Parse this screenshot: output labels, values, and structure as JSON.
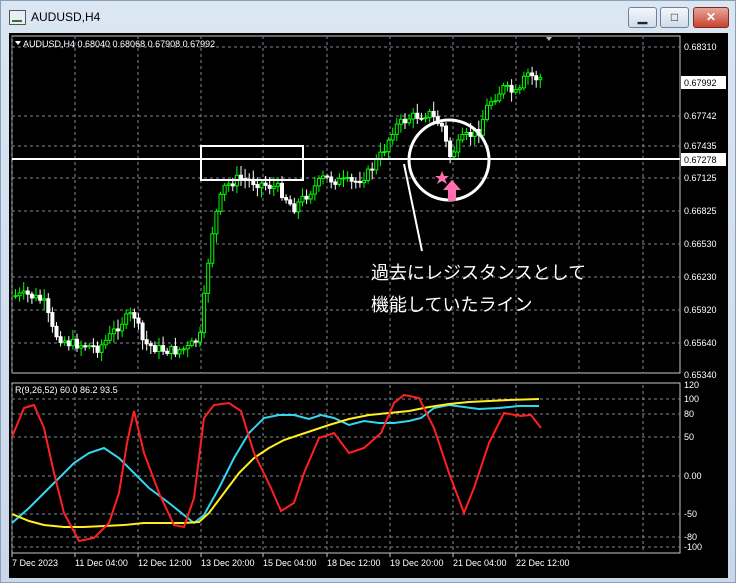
{
  "window": {
    "title": "AUDUSD,H4",
    "minimize_glyph": "▁",
    "maximize_glyph": "□",
    "close_glyph": "✕"
  },
  "chart": {
    "info": "AUDUSD,H4  0.68040 0.68068 0.67908 0.67992",
    "price_ticks": [
      "0.68310",
      "0.67742",
      "0.67435",
      "0.67125",
      "0.66825",
      "0.66530",
      "0.66230",
      "0.65920",
      "0.65640",
      "0.65340"
    ],
    "current_price": "0.67992",
    "line_price": "0.67278",
    "annotation_line1": "過去にレジスタンスとして",
    "annotation_line2": "機能していたライン",
    "colors": {
      "bull": "#00ff00",
      "bear": "#ffffff",
      "grid": "#7f8a94",
      "line": "#ffffff",
      "arrow": "#ff6fae"
    }
  },
  "indicator": {
    "label": "R(9,26,52) 60.0 86.2 93.5",
    "ticks": [
      "120",
      "100",
      "80",
      "50",
      "0.00",
      "-50",
      "-80",
      "-100"
    ],
    "colors": {
      "red": "#ff2020",
      "cyan": "#33d6f0",
      "yellow": "#ffee22"
    }
  },
  "time_axis": [
    "7 Dec 2023",
    "11 Dec 04:00",
    "12 Dec 12:00",
    "13 Dec 20:00",
    "15 Dec 04:00",
    "18 Dec 12:00",
    "19 Dec 20:00",
    "21 Dec 04:00",
    "22 Dec 12:00"
  ]
}
